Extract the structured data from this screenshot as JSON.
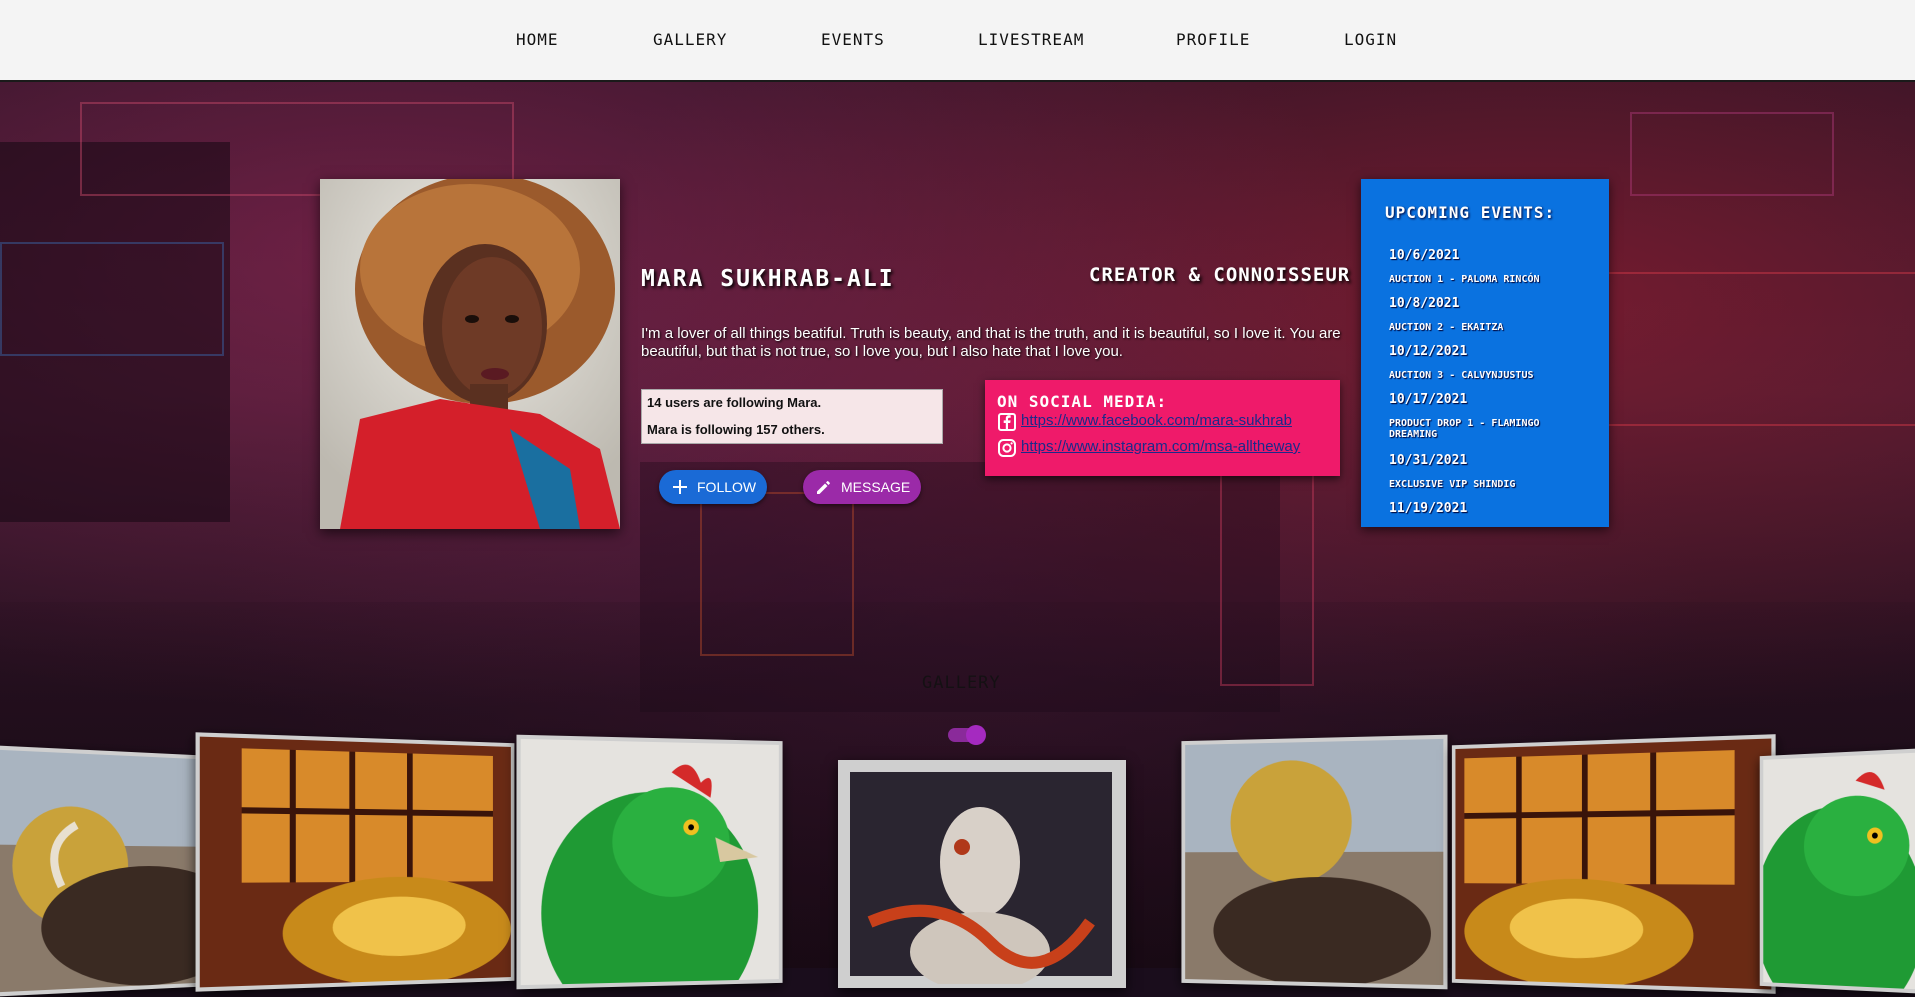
{
  "nav": {
    "items": [
      {
        "label": "HOME"
      },
      {
        "label": "GALLERY"
      },
      {
        "label": "EVENTS"
      },
      {
        "label": "LIVESTREAM"
      },
      {
        "label": "PROFILE"
      },
      {
        "label": "LOGIN"
      }
    ]
  },
  "profile": {
    "name": "MARA SUKHRAB-ALI",
    "role": "CREATOR & CONNOISSEUR",
    "bio": "I'm a lover of all things beatiful. Truth is beauty, and that is the truth, and it is beautiful, so I love it. You are beautiful, but that is not true, so I love you, but I also hate that I love you.",
    "followers_text": "14 users are following Mara.",
    "following_text": "Mara is following 157 others.",
    "follow_label": "FOLLOW",
    "message_label": "MESSAGE"
  },
  "social": {
    "title": "ON SOCIAL MEDIA:",
    "links": [
      {
        "icon": "facebook-icon",
        "url": "https://www.facebook.com/mara-sukhrab"
      },
      {
        "icon": "instagram-icon",
        "url": "https://www.instagram.com/msa-alltheway"
      }
    ]
  },
  "events": {
    "title": "UPCOMING EVENTS:",
    "items": [
      {
        "date": "10/6/2021",
        "name": "AUCTION 1 - PALOMA RINCÓN"
      },
      {
        "date": "10/8/2021",
        "name": "AUCTION 2 - EKAITZA"
      },
      {
        "date": "10/12/2021",
        "name": "AUCTION 3 - CALVYNJUSTUS"
      },
      {
        "date": "10/17/2021",
        "name": "PRODUCT DROP 1 - FLAMINGO DREAMING"
      },
      {
        "date": "10/31/2021",
        "name": "EXCLUSIVE VIP SHINDIG"
      },
      {
        "date": "11/19/2021",
        "name": ""
      }
    ]
  },
  "gallery": {
    "title": "GALLERY",
    "toggle_on": true
  },
  "colors": {
    "social_bg": "#ef1a6a",
    "events_bg": "#0a72e0",
    "follow_btn": "#1a6ad6",
    "message_btn": "#9b2aa8"
  }
}
